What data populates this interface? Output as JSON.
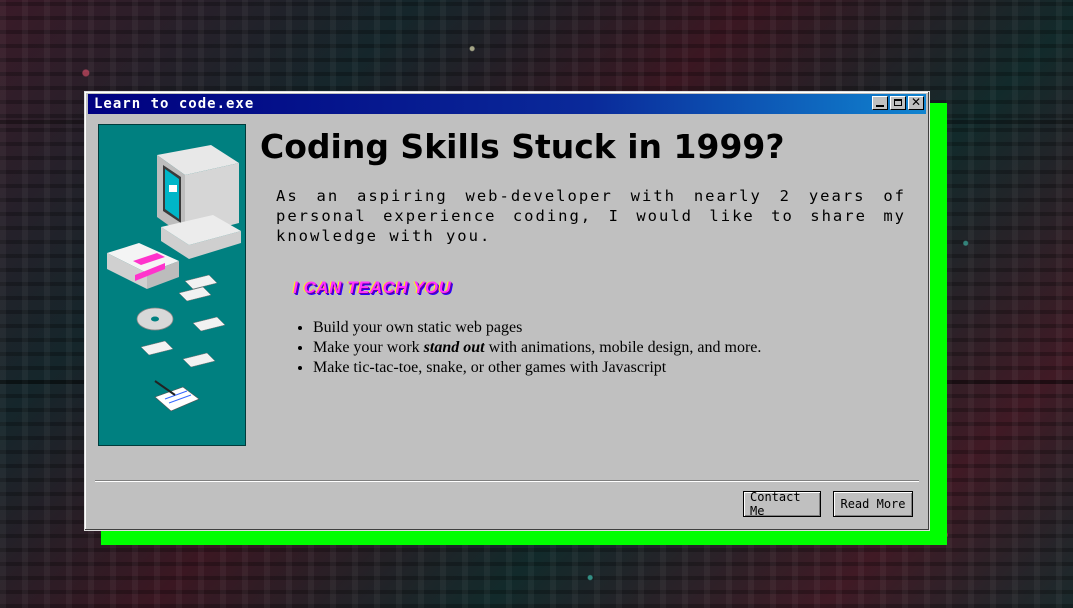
{
  "window": {
    "title": "Learn to code.exe",
    "controls": {
      "minimize_icon": "minimize-icon",
      "maximize_icon": "maximize-icon",
      "close_glyph": "✕"
    }
  },
  "content": {
    "heading": "Coding Skills Stuck in 1999?",
    "intro": "As an aspiring web-developer with nearly 2 years of personal experience coding, I would like to share my knowledge with you.",
    "teach_heading": "I CAN TEACH YOU",
    "list": [
      {
        "text": "Build your own static web pages"
      },
      {
        "before": "Make your work ",
        "emphasis": "stand out",
        "after": " with animations, mobile design, and more."
      },
      {
        "text": "Make tic-tac-toe, snake, or other games with Javascript"
      }
    ]
  },
  "footer": {
    "contact_label": "Contact Me",
    "read_more_label": "Read More"
  },
  "colors": {
    "titlebar": "#000080",
    "window": "#c0c0c0",
    "shadow": "#00ff00",
    "side_panel": "#008080",
    "accent_text": "#ff33ff"
  }
}
